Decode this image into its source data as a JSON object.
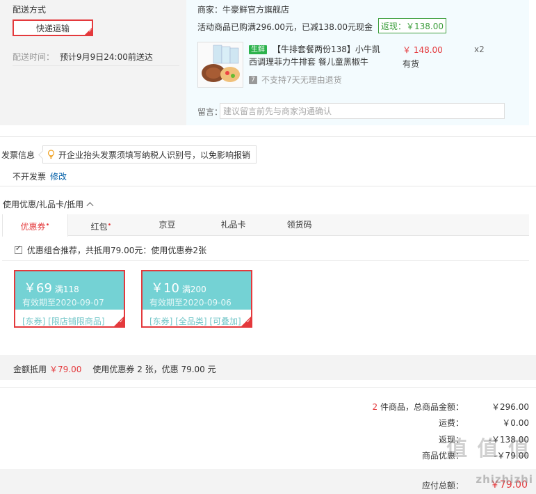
{
  "delivery": {
    "title": "配送方式",
    "method": "快递运输",
    "time_label": "配送时间：",
    "time_value": "预计9月9日24:00前送达"
  },
  "shop": {
    "name": "商家：牛豪鲜官方旗舰店",
    "promo": "活动商品已购满296.00元，已减138.00元现金",
    "rebate": "返现：￥138.00",
    "product": {
      "tag": "生鲜",
      "title": "【牛排套餐两份138】小牛凯西调理菲力牛排套 餐儿童黑椒牛",
      "price": "￥ 148.00",
      "stock": "有货",
      "qty": "x2",
      "no_return": "不支持7天无理由退货",
      "no_return_icon": "7"
    },
    "memo_label": "留言：",
    "memo_placeholder": "建议留言前先与商家沟通确认"
  },
  "invoice": {
    "label": "发票信息",
    "tip": "开企业抬头发票须填写纳税人识别号，以免影响报销",
    "state": "不开发票",
    "edit": "修改"
  },
  "coupons": {
    "heading": "使用优惠/礼品卡/抵用",
    "tabs": [
      {
        "label": "优惠券",
        "dot": "•"
      },
      {
        "label": "红包",
        "dot": "•"
      },
      {
        "label": "京豆",
        "dot": ""
      },
      {
        "label": "礼品卡",
        "dot": ""
      },
      {
        "label": "领货码",
        "dot": ""
      }
    ],
    "combo_text": "优惠组合推荐，共抵用79.00元：使用优惠券2张",
    "items": [
      {
        "amount": "￥69",
        "cond": "满118",
        "expiry": "有效期至2020-09-07",
        "tags": "[东券]  [限店铺限商品]"
      },
      {
        "amount": "￥10",
        "cond": "满200",
        "expiry": "有效期至2020-09-06",
        "tags": "[东券]  [全品类]  [可叠加]"
      }
    ],
    "deduct_label": "金额抵用",
    "deduct_value": "￥79.00",
    "deduct_desc": "使用优惠券 2 张，优惠 79.00 元"
  },
  "summary": {
    "count": "2",
    "count_suffix": " 件商品，总商品金额：",
    "goods_total": "￥296.00",
    "shipping_label": "运费：",
    "shipping": "￥0.00",
    "rebate_label": "返现：",
    "rebate": "-￥138.00",
    "discount_label": "商品优惠：",
    "discount": "-￥79.00",
    "payable_label": "应付总额：",
    "payable": "￥79.00"
  },
  "watermark": {
    "main": "值 值 值",
    "sub": "zhizhizhi"
  },
  "colors": {
    "accent_red": "#e4393c",
    "coupon_teal": "#74d2d4",
    "fresh_green": "#2bb24c",
    "link_blue": "#005ea7"
  }
}
